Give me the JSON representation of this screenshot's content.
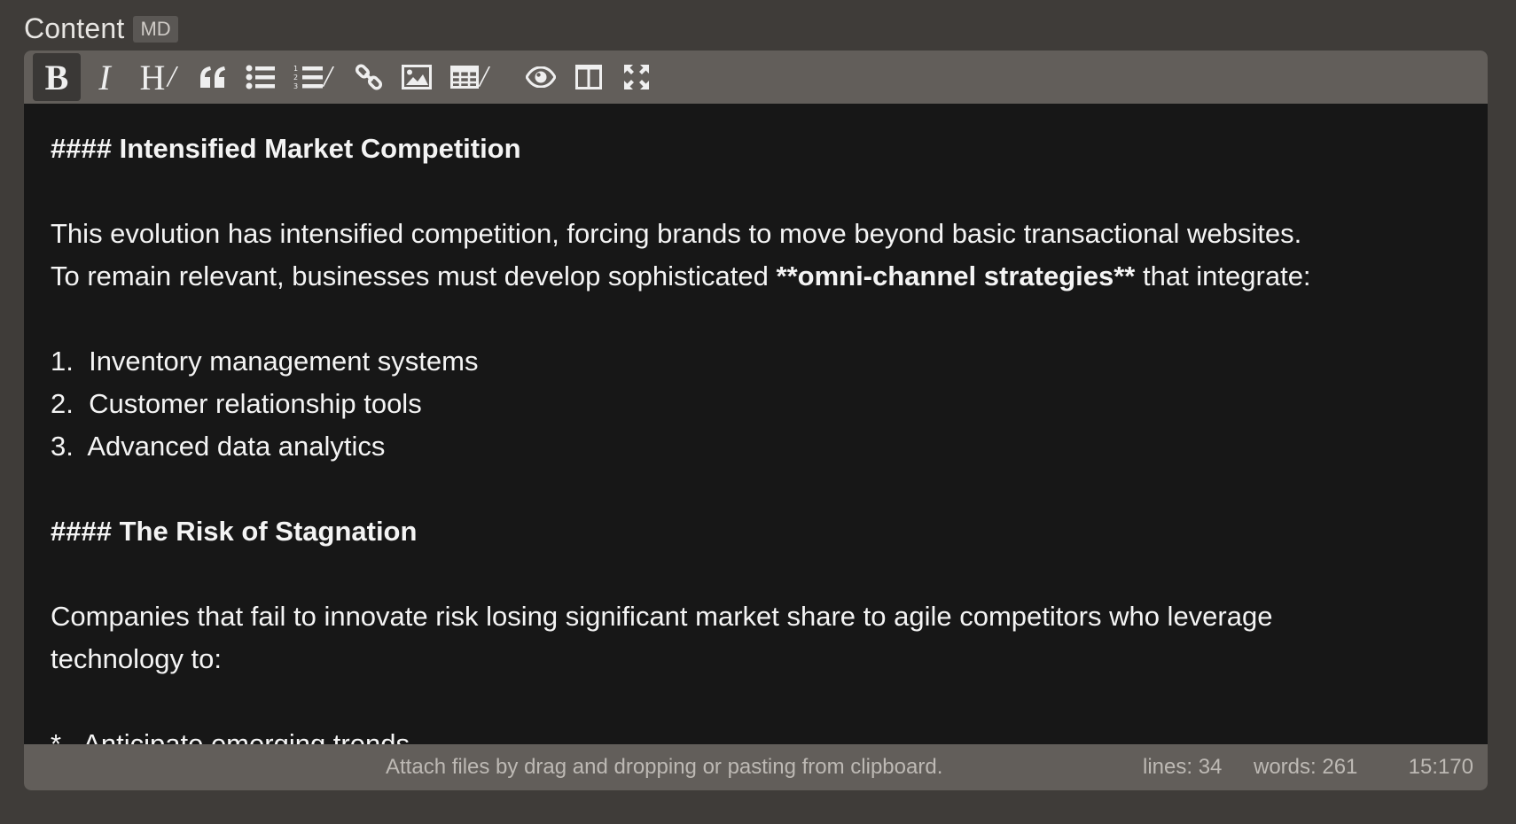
{
  "field": {
    "label": "Content",
    "badge": "MD"
  },
  "toolbar": {
    "buttons": [
      {
        "name": "bold-button",
        "icon": "bold-icon",
        "glyph": "B",
        "active": true
      },
      {
        "name": "italic-button",
        "icon": "italic-icon",
        "glyph": "I"
      },
      {
        "name": "heading-button",
        "icon": "heading-icon",
        "glyph": "H"
      },
      {
        "name": "quote-button",
        "icon": "quote-icon"
      },
      {
        "name": "unordered-list-button",
        "icon": "unordered-list-icon"
      },
      {
        "name": "ordered-list-button",
        "icon": "ordered-list-icon"
      },
      {
        "name": "link-button",
        "icon": "link-icon"
      },
      {
        "name": "image-button",
        "icon": "image-icon"
      },
      {
        "name": "table-button",
        "icon": "table-icon"
      },
      {
        "name": "preview-button",
        "icon": "eye-icon"
      },
      {
        "name": "side-by-side-button",
        "icon": "columns-icon"
      },
      {
        "name": "fullscreen-button",
        "icon": "fullscreen-icon"
      }
    ],
    "separator": "/"
  },
  "content": {
    "lines": [
      {
        "text": "#### Intensified Market Competition",
        "type": "heading"
      },
      {
        "text": "",
        "type": "blank"
      },
      {
        "text": "This evolution has intensified competition, forcing brands to move beyond basic transactional websites.",
        "type": "text"
      },
      {
        "pre": "To remain relevant, businesses must develop sophisticated ",
        "bold": "**omni-channel strategies**",
        "post": " that integrate:",
        "type": "mixed"
      },
      {
        "text": "",
        "type": "blank"
      },
      {
        "text": "1.  Inventory management systems",
        "type": "text"
      },
      {
        "text": "2.  Customer relationship tools",
        "type": "text"
      },
      {
        "text": "3.  Advanced data analytics",
        "type": "text"
      },
      {
        "text": "",
        "type": "blank"
      },
      {
        "text": "#### The Risk of Stagnation",
        "type": "heading"
      },
      {
        "text": "",
        "type": "blank"
      },
      {
        "text": "Companies that fail to innovate risk losing significant market share to agile competitors who leverage",
        "type": "text"
      },
      {
        "text": "technology to:",
        "type": "text"
      },
      {
        "text": "",
        "type": "blank"
      },
      {
        "text": "*   Anticipate emerging trends",
        "type": "text"
      }
    ]
  },
  "statusbar": {
    "hint": "Attach files by drag and dropping or pasting from clipboard.",
    "lines": "lines: 34",
    "words": "words: 261",
    "cursor": "15:170"
  },
  "colors": {
    "page_bg": "#3f3c39",
    "toolbar_bg": "#625e5a",
    "editor_bg": "#171717",
    "text": "#f4f4f4",
    "status_text": "#bdb9b4"
  }
}
